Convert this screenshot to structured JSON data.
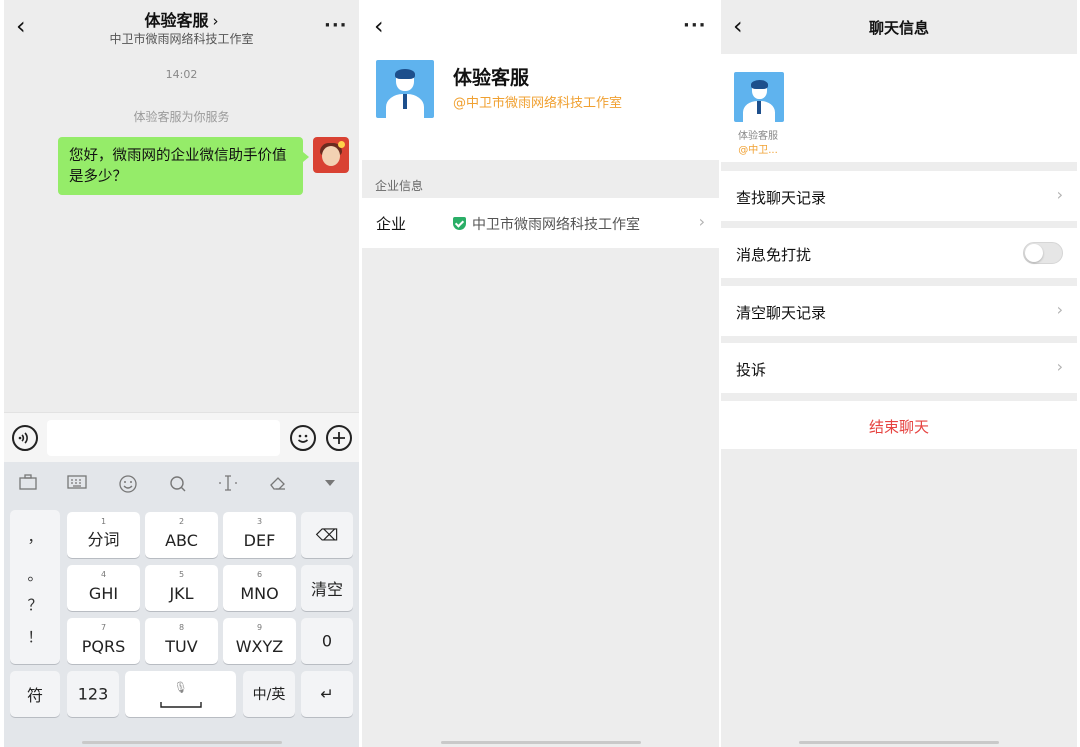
{
  "chat": {
    "title": "体验客服",
    "title_chevron": "›",
    "subtitle": "中卫市微雨网络科技工作室",
    "more": "···",
    "back": "‹",
    "time": "14:02",
    "system_notice": "体验客服为你服务",
    "message": "您好，微雨网的企业微信助手价值是多少？",
    "voice_icon": "voice-icon",
    "emoji_icon": "emoji-icon",
    "plus_icon": "plus-icon"
  },
  "keyboard": {
    "toolbar": [
      "briefcase-icon",
      "keyboard-icon",
      "emoji-icon",
      "search-icon",
      "cursor-icon",
      "clear-icon",
      "collapse-icon"
    ],
    "punct": [
      "，",
      "。",
      "？",
      "！"
    ],
    "keys": [
      {
        "num": "1",
        "label": "分词"
      },
      {
        "num": "2",
        "label": "ABC"
      },
      {
        "num": "3",
        "label": "DEF"
      },
      {
        "num": "4",
        "label": "GHI"
      },
      {
        "num": "5",
        "label": "JKL"
      },
      {
        "num": "6",
        "label": "MNO"
      },
      {
        "num": "7",
        "label": "PQRS"
      },
      {
        "num": "8",
        "label": "TUV"
      },
      {
        "num": "9",
        "label": "WXYZ"
      }
    ],
    "backspace": "⌫",
    "clear": "清空",
    "zero": "0",
    "symbol": "符",
    "num123": "123",
    "lang": "中/英",
    "enter": "↵",
    "mic": "🎙"
  },
  "contact": {
    "back": "‹",
    "more": "···",
    "name": "体验客服",
    "org": "@中卫市微雨网络科技工作室",
    "section_label": "企业信息",
    "row_key": "企业",
    "row_value": "中卫市微雨网络科技工作室",
    "chevron": "›"
  },
  "chat_info": {
    "back": "‹",
    "title": "聊天信息",
    "member_name": "体验客服",
    "member_org": "@中卫...",
    "rows": [
      {
        "label": "查找聊天记录"
      },
      {
        "label": "消息免打扰"
      },
      {
        "label": "清空聊天记录"
      },
      {
        "label": "投诉"
      }
    ],
    "chevron": "›",
    "end_chat": "结束聊天",
    "colors": {
      "danger": "#e64340",
      "org": "#f0a030",
      "bubble": "#95ec69"
    }
  }
}
